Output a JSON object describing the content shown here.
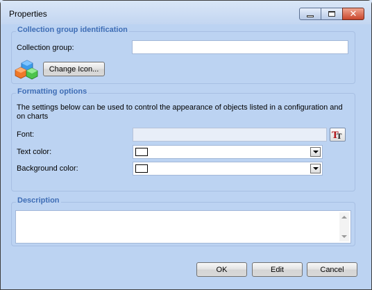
{
  "window": {
    "title": "Properties",
    "buttons": {
      "minimize": "minimize-icon",
      "maximize": "maximize-icon",
      "close": "close-icon"
    }
  },
  "identification": {
    "group_title": "Collection group identification",
    "collection_group_label": "Collection group:",
    "collection_group_value": "",
    "icon": "collection-cubes-icon",
    "change_icon_label": "Change Icon..."
  },
  "formatting": {
    "group_title": "Formatting options",
    "help_text": "The settings below can be used to control the appearance of objects listed in a configuration and on charts",
    "font_label": "Font:",
    "font_value": "",
    "font_button_icon": "font-icon",
    "text_color_label": "Text color:",
    "text_color_value": "#ffffff",
    "background_color_label": "Background color:",
    "background_color_value": "#ffffff"
  },
  "description": {
    "group_title": "Description",
    "value": ""
  },
  "actions": {
    "ok_label": "OK",
    "edit_label": "Edit",
    "cancel_label": "Cancel"
  },
  "colors": {
    "accent": "#3e6db5",
    "window_background": "#bcd3f2"
  }
}
